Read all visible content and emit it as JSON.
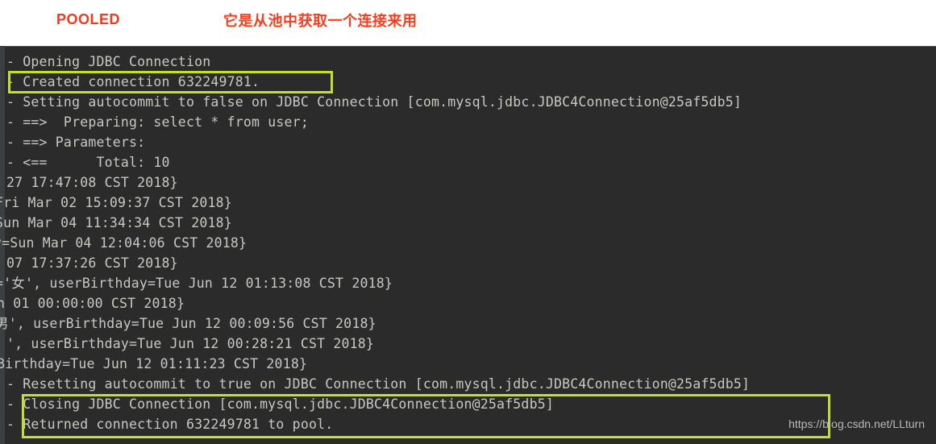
{
  "annotation": {
    "label": "POOLED",
    "note": "它是从池中获取一个连接来用",
    "label_color": "#f03a22",
    "note_color": "#fb3b1e"
  },
  "console": {
    "background_color": "#2b2b2b",
    "text_color": "#c8c8c2",
    "highlight_color": "#c5e02a",
    "lines": [
      "- Opening JDBC Connection",
      "- Created connection 632249781.",
      "- Setting autocommit to false on JDBC Connection [com.mysql.jdbc.JDBC4Connection@25af5db5]",
      "- ==>  Preparing: select * from user;",
      "- ==> Parameters:",
      "- <==      Total: 10",
      "27 17:47:08 CST 2018}",
      "Fri Mar 02 15:09:37 CST 2018}",
      "Sun Mar 04 11:34:34 CST 2018}",
      "y=Sun Mar 04 12:04:06 CST 2018}",
      "07 17:37:26 CST 2018}",
      "='女', userBirthday=Tue Jun 12 01:13:08 CST 2018}",
      "n 01 00:00:00 CST 2018}",
      "男', userBirthday=Tue Jun 12 00:09:56 CST 2018}",
      "', userBirthday=Tue Jun 12 00:28:21 CST 2018}",
      "Birthday=Tue Jun 12 01:11:23 CST 2018}",
      "- Resetting autocommit to true on JDBC Connection [com.mysql.jdbc.JDBC4Connection@25af5db5]",
      "- Closing JDBC Connection [com.mysql.jdbc.JDBC4Connection@25af5db5]",
      "- Returned connection 632249781 to pool."
    ],
    "line_offsets_x": [
      8,
      8,
      8,
      8,
      8,
      8,
      8,
      -6,
      -6,
      -8,
      8,
      -6,
      -4,
      -6,
      8,
      -4,
      8,
      8,
      8
    ],
    "highlights": [
      {
        "name": "created-connection-highlight",
        "line": 1
      },
      {
        "name": "closing-returned-highlight",
        "lines": [
          17,
          18
        ]
      }
    ]
  },
  "watermark": {
    "text": "https://blog.csdn.net/LLturn"
  }
}
